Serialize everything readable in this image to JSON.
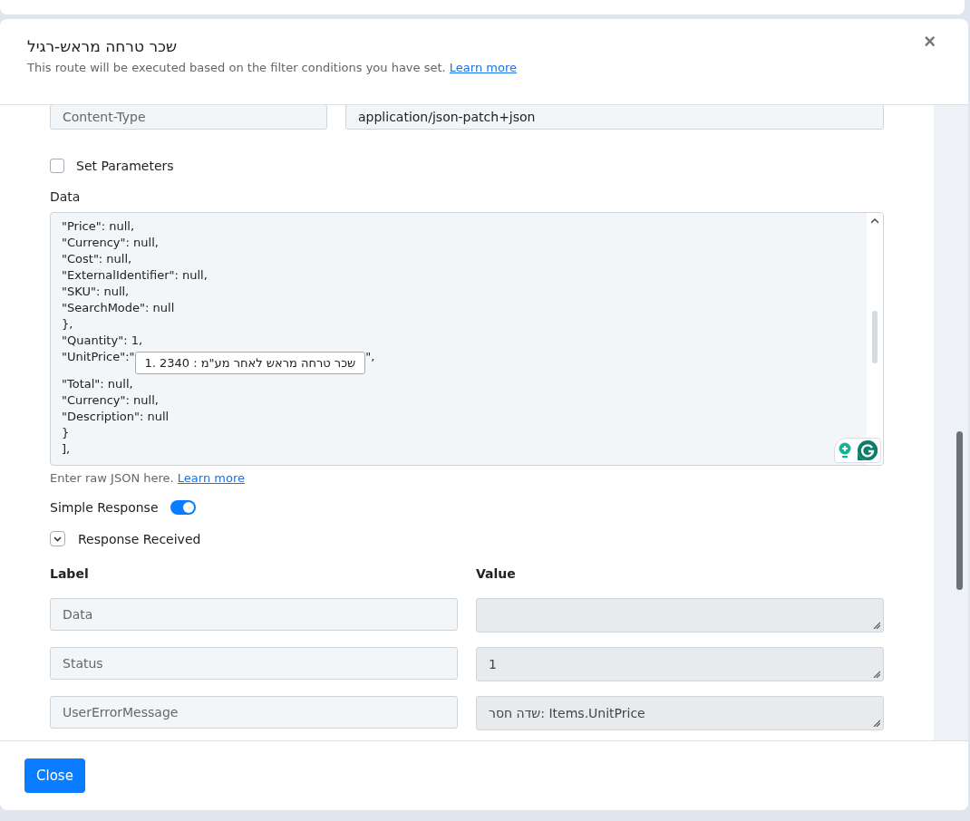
{
  "modal": {
    "title": "שכר טרחה מראש-רגיל",
    "subtitle": "This route will be executed based on the filter conditions you have set.",
    "subtitle_link": "Learn more",
    "close": "×"
  },
  "header_row": {
    "key": "Content-Type",
    "value": "application/json-patch+json"
  },
  "set_parameters": {
    "label": "Set Parameters",
    "checked": false
  },
  "data": {
    "label": "Data",
    "lines": [
      {
        "kind": "text",
        "text": "\"Price\": null,"
      },
      {
        "kind": "text",
        "text": "\"Currency\": null,"
      },
      {
        "kind": "text",
        "text": "\"Cost\": null,"
      },
      {
        "kind": "text",
        "text": "\"ExternalIdentifier\": null,"
      },
      {
        "kind": "text",
        "text": "\"SKU\": null,"
      },
      {
        "kind": "text",
        "text": "\"SearchMode\": null"
      },
      {
        "kind": "text",
        "text": "},"
      },
      {
        "kind": "text",
        "text": "\"Quantity\": 1,"
      },
      {
        "kind": "field",
        "prefix": "\"UnitPrice\":\"",
        "value": "שכר טרחה מראש לאחר מע\"מ : 2340 .1",
        "suffix": "\","
      },
      {
        "kind": "text",
        "text": "\"Total\": null,"
      },
      {
        "kind": "text",
        "text": "\"Currency\": null,"
      },
      {
        "kind": "text",
        "text": "\"Description\": null"
      },
      {
        "kind": "text",
        "text": "}"
      },
      {
        "kind": "text",
        "text": "],"
      }
    ],
    "hint": "Enter raw JSON here.",
    "hint_link": "Learn more"
  },
  "simple_response": {
    "label": "Simple Response",
    "on": true
  },
  "response_received": {
    "label": "Response Received",
    "expanded": true
  },
  "table": {
    "columns": [
      "Label",
      "Value"
    ],
    "rows": [
      {
        "label": "Data",
        "value": ""
      },
      {
        "label": "Status",
        "value": "1"
      },
      {
        "label": "UserErrorMessage",
        "value": "שדה חסר: Items.UnitPrice"
      }
    ]
  },
  "footer": {
    "button": "Close"
  }
}
